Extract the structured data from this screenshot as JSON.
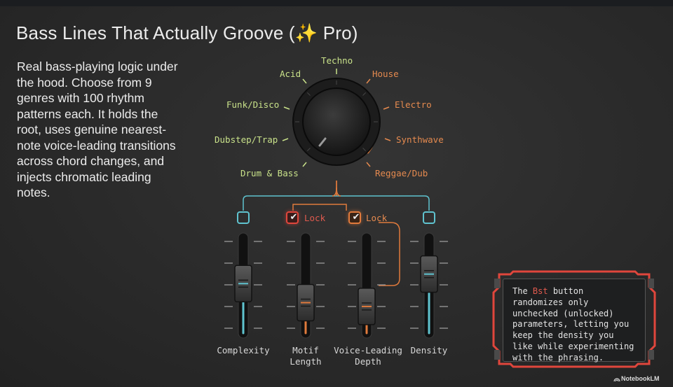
{
  "title": "Bass Lines That Actually Groove (✨ Pro)",
  "description": "Real bass-playing logic under the hood. Choose from 9 genres with 100 rhythm patterns each. It holds the root, uses genuine nearest-note voice-leading transitions across chord changes, and injects chromatic leading notes.",
  "genres": [
    {
      "label": "Techno",
      "color": "#c9e28a"
    },
    {
      "label": "Acid",
      "color": "#c9e28a"
    },
    {
      "label": "House",
      "color": "#e58a4f"
    },
    {
      "label": "Funk/Disco",
      "color": "#c9e28a"
    },
    {
      "label": "Electro",
      "color": "#e58a4f"
    },
    {
      "label": "Dubstep/Trap",
      "color": "#c9e28a"
    },
    {
      "label": "Synthwave",
      "color": "#e58a4f"
    },
    {
      "label": "Drum & Bass",
      "color": "#c9e28a"
    },
    {
      "label": "Reggae/Dub",
      "color": "#e58a4f"
    }
  ],
  "faders": [
    {
      "label_line1": "Complexity",
      "label_line2": "",
      "locked": false,
      "lock_label": "",
      "color": "#5fc3cf",
      "level": 0.52
    },
    {
      "label_line1": "Motif",
      "label_line2": "Length",
      "locked": true,
      "lock_label": "Lock",
      "color": "#e07a3c",
      "level": 0.32
    },
    {
      "label_line1": "Voice-Leading",
      "label_line2": "Depth",
      "locked": true,
      "lock_label": "Lock",
      "color": "#e07a3c",
      "level": 0.28
    },
    {
      "label_line1": "Density",
      "label_line2": "",
      "locked": false,
      "lock_label": "",
      "color": "#5fc3cf",
      "level": 0.62
    }
  ],
  "note": {
    "prefix": "The ",
    "highlight": "Bst",
    "suffix": " button randomizes only unchecked (unlocked) parameters, letting you keep the density you like while experimenting with the phrasing."
  },
  "brand": "NotebookLM",
  "colors": {
    "green": "#b8dc6a",
    "orange": "#e07a3c",
    "cyan": "#5fc3cf",
    "red": "#e0463c"
  }
}
